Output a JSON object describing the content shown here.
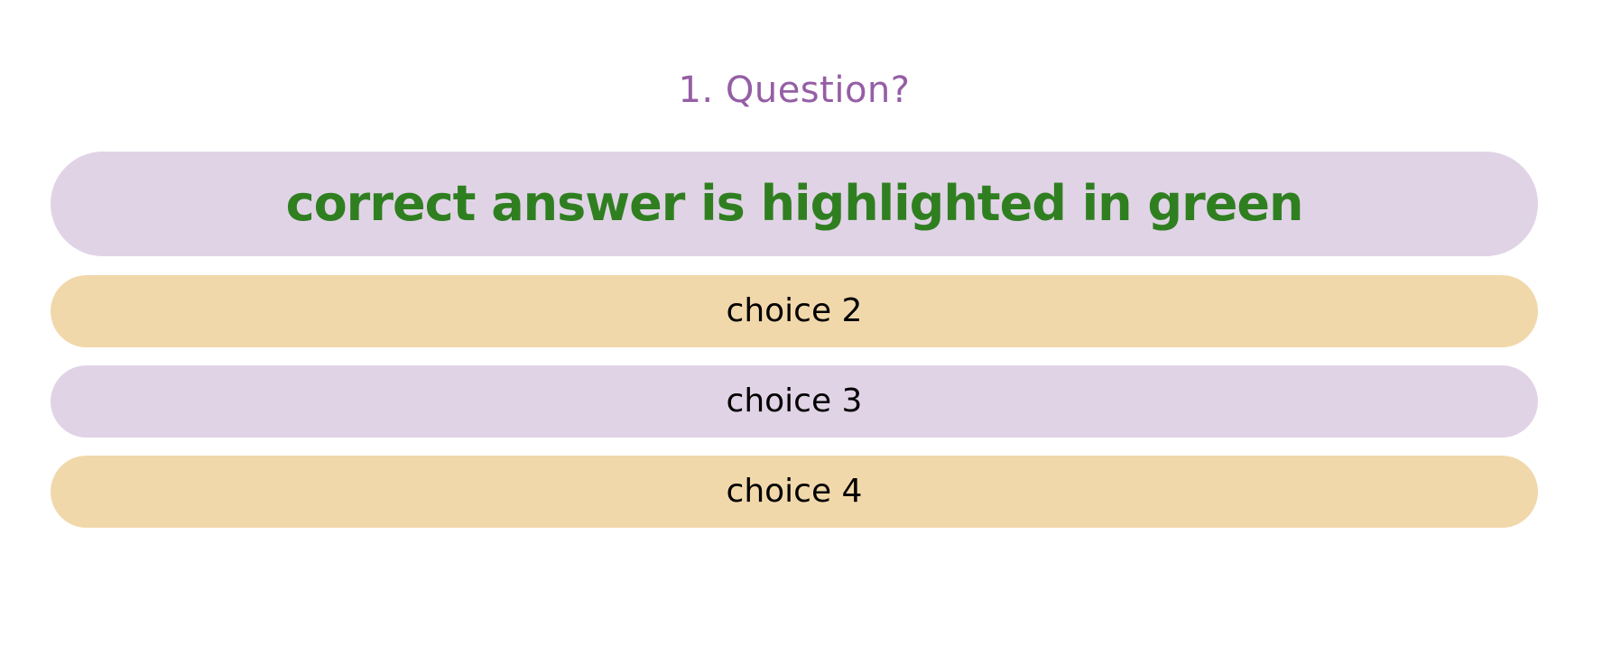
{
  "question": {
    "title": "1. Question?"
  },
  "choices": [
    {
      "label": "correct answer is highlighted in green",
      "correct": true
    },
    {
      "label": "choice 2",
      "correct": false
    },
    {
      "label": "choice 3",
      "correct": false
    },
    {
      "label": "choice 4",
      "correct": false
    }
  ],
  "colors": {
    "question_text": "#955ea5",
    "correct_text": "#2f7f21",
    "lavender_fill": "#e1d3e6",
    "peach_fill": "#f1d8aa",
    "choice_text": "#000000"
  }
}
